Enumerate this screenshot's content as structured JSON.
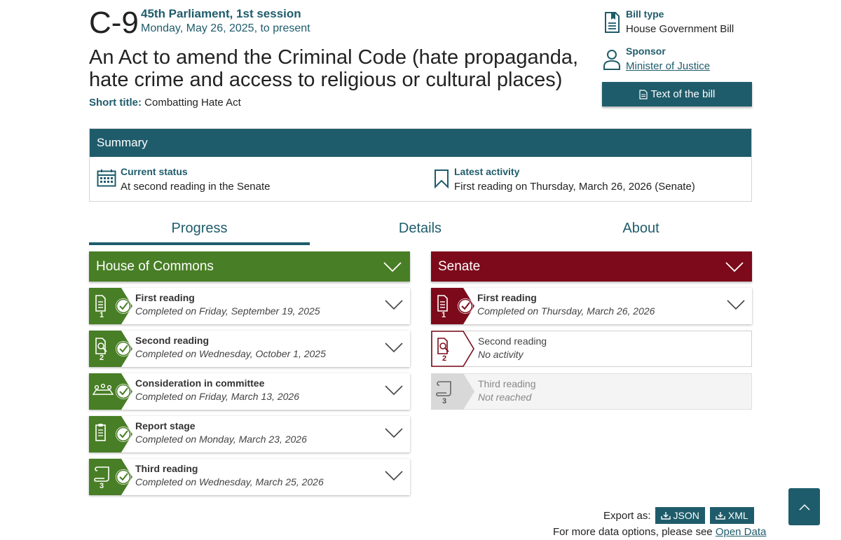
{
  "bill": {
    "number": "C-9",
    "session": "45th Parliament, 1st session",
    "dates": "Monday, May 26, 2025, to present",
    "title": "An Act to amend the Criminal Code (hate propaganda, hate crime and access to religious or cultural places)",
    "short_title_label": "Short title:",
    "short_title": "Combatting Hate Act"
  },
  "meta": {
    "bill_type_label": "Bill type",
    "bill_type": "House Government Bill",
    "sponsor_label": "Sponsor",
    "sponsor": "Minister of Justice",
    "text_button": "Text of the bill"
  },
  "summary": {
    "heading": "Summary",
    "status_label": "Current status",
    "status": "At second reading in the Senate",
    "activity_label": "Latest activity",
    "activity": "First reading on Thursday, March 26, 2026 (Senate)"
  },
  "tabs": [
    "Progress",
    "Details",
    "About"
  ],
  "colors": {
    "accent": "#1f5c6b",
    "commons": "#487e25",
    "senate": "#7c0a1b",
    "inactive": "#d8d8d8"
  },
  "commons": {
    "heading": "House of Commons",
    "stages": [
      {
        "name": "First reading",
        "status": "Completed on Friday, September 19, 2025",
        "num": "1",
        "icon": "document-icon"
      },
      {
        "name": "Second reading",
        "status": "Completed on Wednesday, October 1, 2025",
        "num": "2",
        "icon": "magnify-document-icon"
      },
      {
        "name": "Consideration in committee",
        "status": "Completed on Friday, March 13, 2026",
        "num": "",
        "icon": "committee-icon"
      },
      {
        "name": "Report stage",
        "status": "Completed on Monday, March 23, 2026",
        "num": "",
        "icon": "clipboard-icon"
      },
      {
        "name": "Third reading",
        "status": "Completed on Wednesday, March 25, 2026",
        "num": "3",
        "icon": "scroll-icon"
      }
    ]
  },
  "senate": {
    "heading": "Senate",
    "stages": [
      {
        "name": "First reading",
        "status": "Completed on Thursday, March 26, 2026",
        "num": "1",
        "icon": "document-icon"
      },
      {
        "name": "Second reading",
        "status": "No activity",
        "num": "2",
        "icon": "magnify-document-icon"
      },
      {
        "name": "Third reading",
        "status": "Not reached",
        "num": "3",
        "icon": "scroll-icon"
      }
    ]
  },
  "export": {
    "label": "Export as:",
    "json": "JSON",
    "xml": "XML",
    "more": "For more data options, please see",
    "open_data": "Open Data"
  }
}
